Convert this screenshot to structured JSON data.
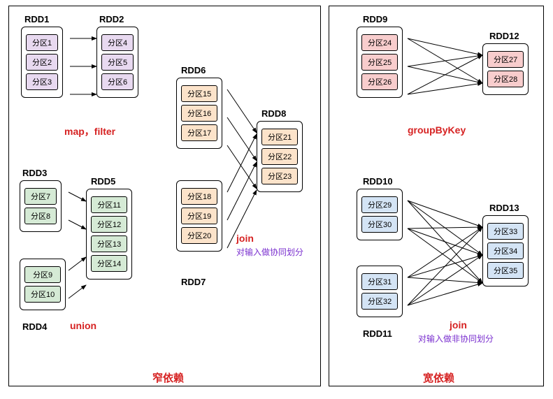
{
  "rdds": {
    "rdd1": {
      "label": "RDD1",
      "partitions": [
        "分区1",
        "分区2",
        "分区3"
      ]
    },
    "rdd2": {
      "label": "RDD2",
      "partitions": [
        "分区4",
        "分区5",
        "分区6"
      ]
    },
    "rdd3": {
      "label": "RDD3",
      "partitions": [
        "分区7",
        "分区8"
      ]
    },
    "rdd4": {
      "label": "RDD4",
      "partitions": [
        "分区9",
        "分区10"
      ]
    },
    "rdd5": {
      "label": "RDD5",
      "partitions": [
        "分区11",
        "分区12",
        "分区13",
        "分区14"
      ]
    },
    "rdd6": {
      "label": "RDD6",
      "partitions": [
        "分区15",
        "分区16",
        "分区17"
      ]
    },
    "rdd7": {
      "label": "RDD7",
      "partitions": [
        "分区18",
        "分区19",
        "分区20"
      ]
    },
    "rdd8": {
      "label": "RDD8",
      "partitions": [
        "分区21",
        "分区22",
        "分区23"
      ]
    },
    "rdd9": {
      "label": "RDD9",
      "partitions": [
        "分区24",
        "分区25",
        "分区26"
      ]
    },
    "rdd10": {
      "label": "RDD10",
      "partitions": [
        "分区29",
        "分区30"
      ]
    },
    "rdd11": {
      "label": "RDD11",
      "partitions": [
        "分区31",
        "分区32"
      ]
    },
    "rdd12": {
      "label": "RDD12",
      "partitions": [
        "分区27",
        "分区28"
      ]
    },
    "rdd13": {
      "label": "RDD13",
      "partitions": [
        "分区33",
        "分区34",
        "分区35"
      ]
    }
  },
  "captions": {
    "mapfilter": "map，filter",
    "union": "union",
    "join1": "join",
    "join1_note": "对输入做协同划分",
    "groupByKey": "groupByKey",
    "join2": "join",
    "join2_note": "对输入做非协同划分",
    "narrow": "窄依赖",
    "wide": "宽依赖"
  },
  "chart_data": {
    "type": "diagram",
    "title": "RDD dependency illustration (narrow vs wide dependency)",
    "sections": [
      {
        "name": "窄依赖",
        "groups": [
          {
            "op": "map, filter",
            "from": "RDD1",
            "to": "RDD2",
            "mapping": [
              [
                "分区1",
                "分区4"
              ],
              [
                "分区2",
                "分区5"
              ],
              [
                "分区3",
                "分区6"
              ]
            ],
            "pattern": "one-to-one"
          },
          {
            "op": "union",
            "from": [
              "RDD3",
              "RDD4"
            ],
            "to": "RDD5",
            "mapping": [
              [
                "分区7",
                "分区11"
              ],
              [
                "分区8",
                "分区12"
              ],
              [
                "分区9",
                "分区13"
              ],
              [
                "分区10",
                "分区14"
              ]
            ],
            "pattern": "one-to-one"
          },
          {
            "op": "join (co-partitioned)",
            "from": [
              "RDD6",
              "RDD7"
            ],
            "to": "RDD8",
            "mapping": [
              [
                "分区15",
                "分区21"
              ],
              [
                "分区16",
                "分区22"
              ],
              [
                "分区17",
                "分区23"
              ],
              [
                "分区18",
                "分区21"
              ],
              [
                "分区19",
                "分区22"
              ],
              [
                "分区20",
                "分区23"
              ]
            ],
            "pattern": "many-to-one"
          }
        ]
      },
      {
        "name": "宽依赖",
        "groups": [
          {
            "op": "groupByKey",
            "from": "RDD9",
            "to": "RDD12",
            "mapping": "all-to-all",
            "pattern": "shuffle"
          },
          {
            "op": "join (non co-partitioned)",
            "from": [
              "RDD10",
              "RDD11"
            ],
            "to": "RDD13",
            "mapping": "all-to-all",
            "pattern": "shuffle"
          }
        ]
      }
    ]
  }
}
